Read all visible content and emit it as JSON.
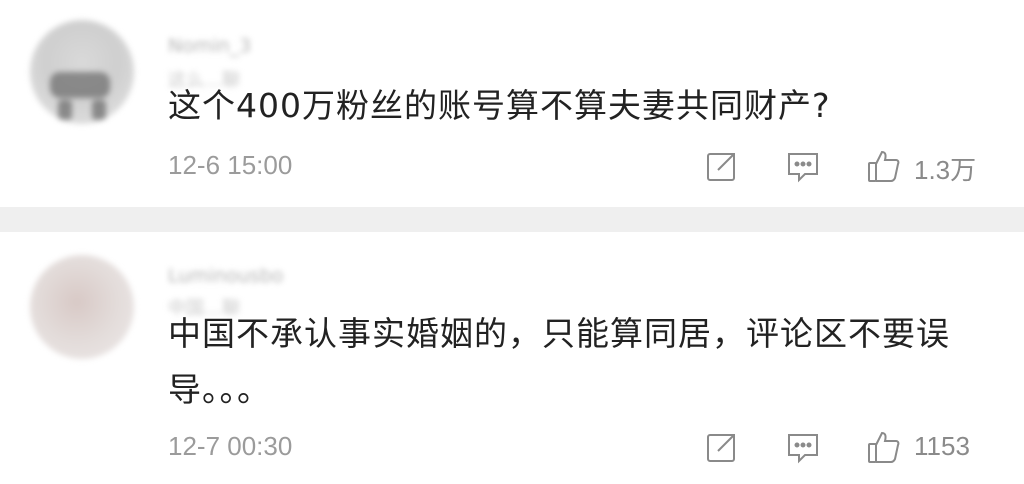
{
  "comments": [
    {
      "username": "Nomin_3",
      "reply_hint": "这么…聊",
      "text": "这个400万粉丝的账号算不算夫妻共同财产?",
      "timestamp": "12-6 15:00",
      "like_count": "1.3万",
      "icons": [
        "share-icon",
        "comment-icon",
        "like-icon"
      ]
    },
    {
      "username": "Luminousbo",
      "reply_hint": "中国…聊",
      "text": "中国不承认事实婚姻的，只能算同居，评论区不要误导。。。",
      "timestamp": "12-7 00:30",
      "like_count": "1153",
      "icons": [
        "share-icon",
        "comment-icon",
        "like-icon"
      ]
    }
  ],
  "colors": {
    "text": "#222222",
    "meta": "#9b9b9b",
    "separator": "#efefef"
  }
}
